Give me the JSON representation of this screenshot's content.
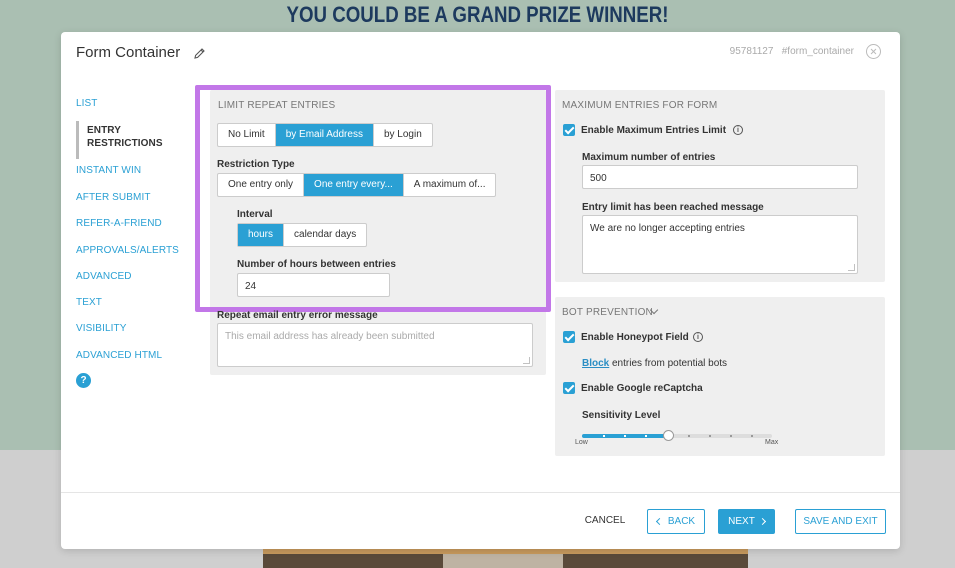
{
  "banner": "YOU COULD BE A GRAND PRIZE WINNER!",
  "modal": {
    "title": "Form Container",
    "meta": "95781127   #form_container"
  },
  "sidebar": {
    "items": [
      {
        "label": "LIST"
      },
      {
        "label": "ENTRY"
      },
      {
        "label": "RESTRICTIONS"
      },
      {
        "label": "INSTANT WIN"
      },
      {
        "label": "AFTER SUBMIT"
      },
      {
        "label": "REFER-A-FRIEND"
      },
      {
        "label": "APPROVALS/ALERTS"
      },
      {
        "label": "ADVANCED"
      },
      {
        "label": "TEXT"
      },
      {
        "label": "VISIBILITY"
      },
      {
        "label": "ADVANCED HTML"
      }
    ],
    "help": "?"
  },
  "limit": {
    "title": "LIMIT REPEAT ENTRIES",
    "mode_options": [
      "No Limit",
      "by Email Address",
      "by Login"
    ],
    "restriction_label": "Restriction Type",
    "restriction_options": [
      "One entry only",
      "One entry every...",
      "A maximum of..."
    ],
    "interval_label": "Interval",
    "interval_options": [
      "hours",
      "calendar days"
    ],
    "hours_label": "Number of hours between entries",
    "hours_value": "24",
    "error_label": "Repeat email entry error message",
    "error_placeholder": "This email address has already been submitted"
  },
  "max_entries": {
    "title": "MAXIMUM ENTRIES FOR FORM",
    "enable_label": "Enable Maximum Entries Limit",
    "max_label": "Maximum number of entries",
    "max_value": "500",
    "message_label": "Entry limit has been reached message",
    "message_value": "We are no longer accepting entries"
  },
  "bot": {
    "title": "BOT PREVENTION",
    "honeypot_label": "Enable Honeypot Field",
    "block_link": "Block",
    "block_text": "entries from potential bots",
    "recaptcha_label": "Enable Google reCaptcha",
    "sensitivity_label": "Sensitivity Level",
    "slider_min": "Low",
    "slider_max": "Max",
    "sensitivity_fraction": 0.45
  },
  "footer": {
    "cancel": "CANCEL",
    "back": "BACK",
    "next": "NEXT",
    "save": "SAVE AND EXIT"
  },
  "colors": {
    "accent": "#2aa0d4",
    "highlight": "#c277e8"
  }
}
